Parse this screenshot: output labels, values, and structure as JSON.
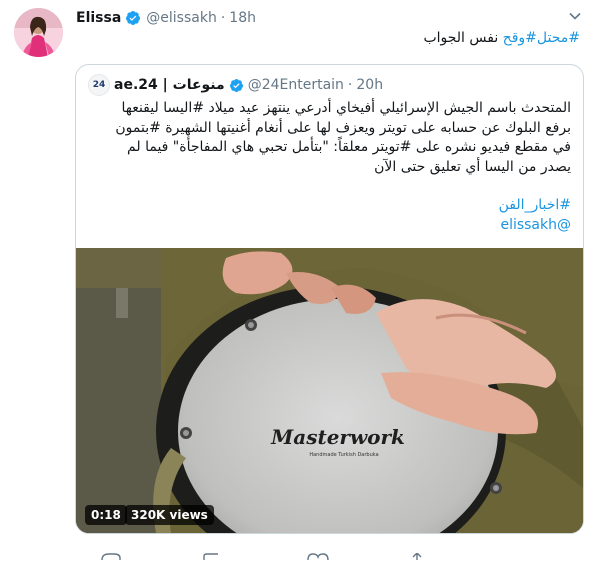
{
  "tweet": {
    "author_name": "Elissa",
    "handle": "@elissakh",
    "separator": "·",
    "time": "18h",
    "text_plain": "نفس الجواب",
    "hashtag_1": "#وقح",
    "hashtag_2": "#محتل"
  },
  "quote": {
    "avatar_text": "24",
    "author_name": "منوعات | 24.ae",
    "handle": "@24Entertain",
    "separator": "·",
    "time": "20h",
    "lines": [
      "المتحدث باسم الجيش الإسرائيلي أفيخاي أدرعي ينتهز عيد ميلاد #اليسا ليقنعها",
      "برفع البلوك عن حسابه على تويتر ويعزف لها على أنغام أغنيتها الشهيرة #بتمون",
      "في مقطع فيديو نشره على #تويتر معلقاً: \"بتأمل تحبي هاي المفاجأة\" فيما لم",
      "يصدر من اليسا أي تعليق حتى الآن"
    ],
    "hashtag_line": "#اخبار_الفن",
    "mention_line": "@elissakh",
    "media": {
      "drum_brand": "Masterwork",
      "drum_subtext": "Handmade Turkish Darbuka",
      "duration": "0:18",
      "views": "320K views"
    }
  },
  "colors": {
    "link": "#1b95e0",
    "verified": "#1da1f2",
    "secondary_text": "#657786",
    "border": "#ccd6dd"
  },
  "icons": {
    "verified": "verified-badge-icon",
    "caret": "chevron-down-icon"
  }
}
